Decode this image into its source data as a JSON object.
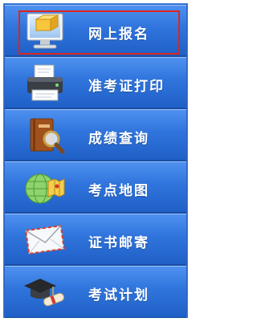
{
  "menu": {
    "items": [
      {
        "label": "网上报名",
        "icon": "monitor-icon",
        "selected": true
      },
      {
        "label": "准考证打印",
        "icon": "printer-icon",
        "selected": false
      },
      {
        "label": "成绩查询",
        "icon": "book-magnifier-icon",
        "selected": false
      },
      {
        "label": "考点地图",
        "icon": "globe-map-icon",
        "selected": false
      },
      {
        "label": "证书邮寄",
        "icon": "envelope-icon",
        "selected": false
      },
      {
        "label": "考试计划",
        "icon": "graduation-cap-icon",
        "selected": false
      }
    ]
  },
  "colors": {
    "item_top": "#4f92f0",
    "item_bottom": "#1f5fc6",
    "selection_border": "#e0241b",
    "label": "#ffffff"
  }
}
